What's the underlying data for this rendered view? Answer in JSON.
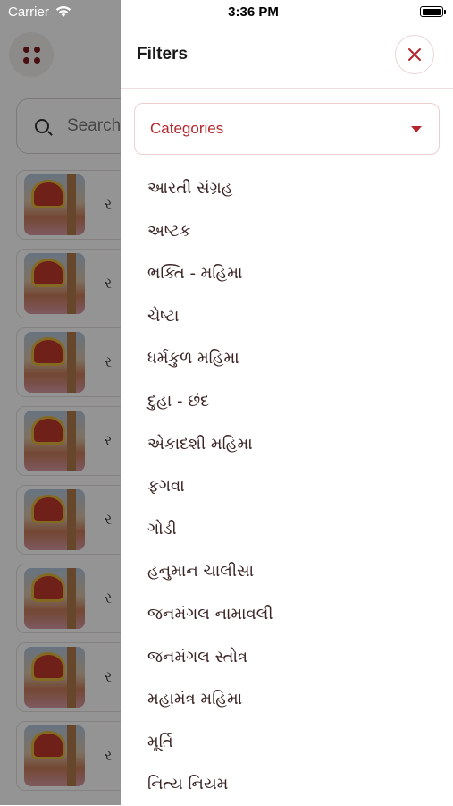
{
  "status_bar": {
    "carrier": "Carrier",
    "time": "3:36 PM"
  },
  "background": {
    "search_placeholder": "Search",
    "list_item_letter": "ર",
    "list_count": 8
  },
  "drawer": {
    "title": "Filters",
    "category_select": {
      "label": "Categories"
    },
    "categories": [
      "આરતી સંગ્રહ",
      "અષ્ટક",
      "ભક્તિ - મહિમા",
      "ચેષ્ટા",
      "ધર્મકુળ મહિમા",
      "દુહા - છંદ",
      "એકાદશી મહિમા",
      "ફગવા",
      "ગોડી",
      "હનુમાન ચાલીસા",
      "જનમંગલ નામાવલી",
      "જનમંગલ સ્તોત્ર",
      "મહામંત્ર મહિમા",
      "મૂર્તિ",
      "નિત્ય નિયમ"
    ]
  },
  "colors": {
    "accent": "#b3282d",
    "scrim": "rgba(0,0,0,0.42)"
  },
  "icons": [
    "menu-grid-icon",
    "search-icon",
    "wifi-icon",
    "battery-icon",
    "close-icon",
    "chevron-down-icon"
  ]
}
